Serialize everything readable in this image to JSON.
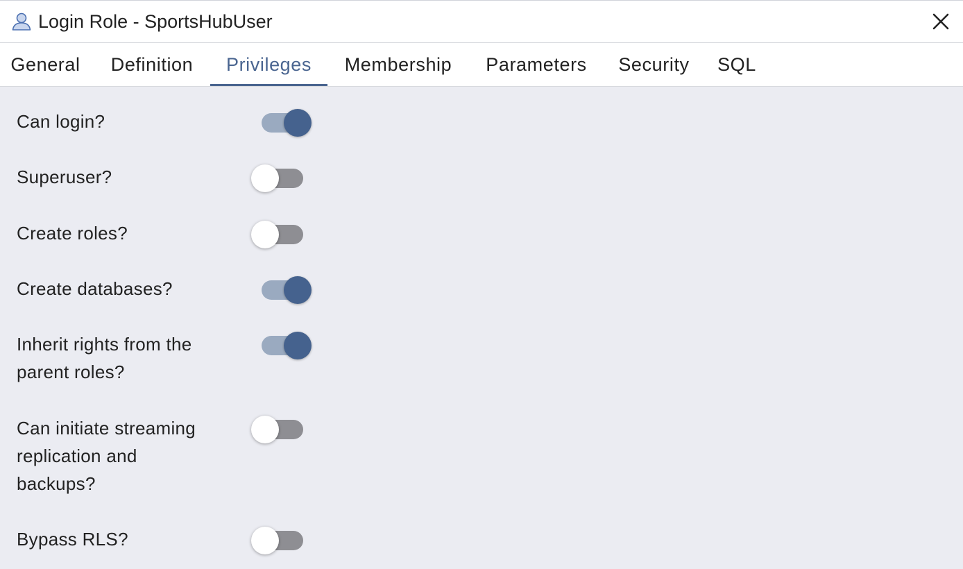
{
  "dialog": {
    "title": "Login Role - SportsHubUser",
    "title_icon": "user-icon",
    "close_icon": "close-icon"
  },
  "tabs": [
    {
      "label": "General",
      "active": false
    },
    {
      "label": "Definition",
      "active": false
    },
    {
      "label": "Privileges",
      "active": true
    },
    {
      "label": "Membership",
      "active": false
    },
    {
      "label": "Parameters",
      "active": false
    },
    {
      "label": "Security",
      "active": false
    },
    {
      "label": "SQL",
      "active": false
    }
  ],
  "privileges": [
    {
      "label": "Can login?",
      "value": true
    },
    {
      "label": "Superuser?",
      "value": false
    },
    {
      "label": "Create roles?",
      "value": false
    },
    {
      "label": "Create databases?",
      "value": true
    },
    {
      "label": "Inherit rights from the parent roles?",
      "value": true
    },
    {
      "label": "Can initiate streaming replication and backups?",
      "value": false
    },
    {
      "label": "Bypass RLS?",
      "value": false
    }
  ],
  "colors": {
    "accent": "#45628e",
    "switch_on_track": "#9aaac0",
    "switch_off_track": "#8e8e93",
    "panel_background": "#ebecf2"
  }
}
